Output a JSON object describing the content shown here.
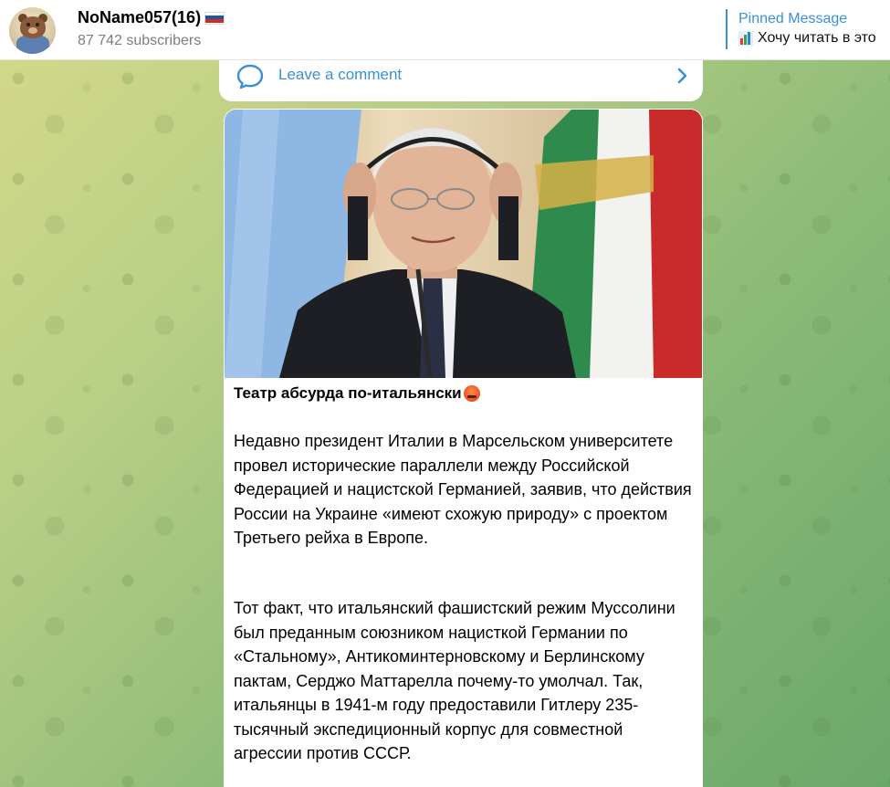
{
  "header": {
    "channel_name": "NoName057(16)",
    "subscribers": "87 742 subscribers",
    "pinned_title": "Pinned Message",
    "pinned_text": "Хочу читать в это"
  },
  "comment_bar": {
    "label": "Leave a comment"
  },
  "post": {
    "title": "Театр абсурда по-итальянски",
    "paragraph_1": "Недавно президент Италии в Марсельском университете провел исторические параллели между Российской Федерацией и нацистской Германией, заявив, что действия России на Украине «имеют схожую природу» с проектом Третьего рейха в Европе.",
    "paragraph_2": "Тот факт, что итальянский фашистский режим Муссолини был преданным союзником нацисткой Германии по «Стальному», Антикоминтерновскому и Берлинскому пактам, Серджо Маттарелла почему-то умолчал. Так, итальянцы в 1941-м году предоставили Гитлеру 235-тысячный экспедиционный корпус для совместной агрессии против СССР."
  },
  "colors": {
    "accent": "#3a8fd6",
    "flag_white": "#ffffff",
    "flag_blue": "#1c57a5",
    "flag_red": "#d52b1e"
  },
  "icons": {
    "avatar": "bear-avatar",
    "flag": "russia-flag-icon",
    "pinned_emoji": "bar-chart-icon",
    "comment": "chat-bubble-icon",
    "chevron": "chevron-right-icon",
    "title_emoji": "angry-face-icon"
  }
}
